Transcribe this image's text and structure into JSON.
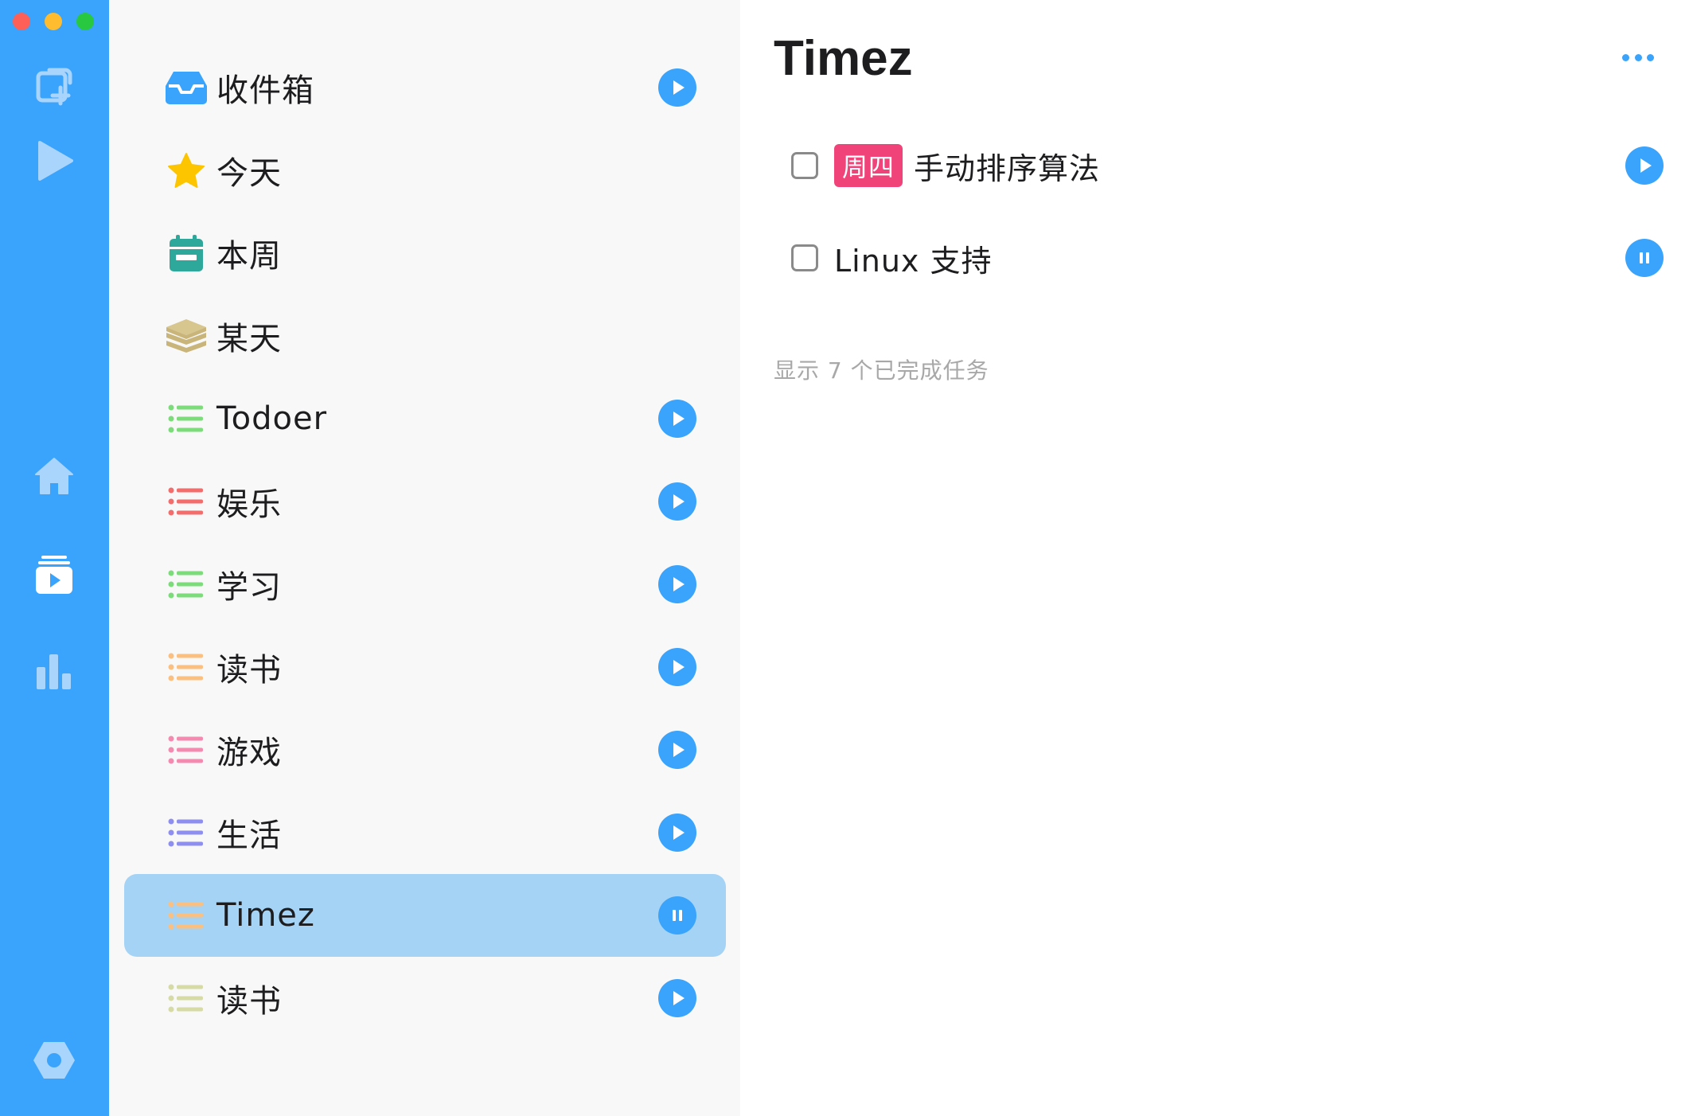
{
  "app": {
    "accent_color": "#3aa3fb",
    "rail": {
      "buttons": [
        {
          "name": "new-task-icon"
        },
        {
          "name": "start-timer-icon"
        },
        {
          "name": "home-icon"
        },
        {
          "name": "timer-list-icon"
        },
        {
          "name": "statistics-icon"
        },
        {
          "name": "settings-icon"
        }
      ]
    }
  },
  "sidebar": {
    "items": [
      {
        "label": "收件箱",
        "icon": "inbox-icon",
        "icon_color": "#3aa3fb",
        "action": "play"
      },
      {
        "label": "今天",
        "icon": "star-icon",
        "icon_color": "#fdc500",
        "action": "none"
      },
      {
        "label": "本周",
        "icon": "calendar-icon",
        "icon_color": "#2ea89b",
        "action": "none"
      },
      {
        "label": "某天",
        "icon": "layers-icon",
        "icon_color": "#d4c089",
        "action": "none"
      },
      {
        "label": "Todoer",
        "icon": "list-icon",
        "icon_color": "#7ddc7a",
        "action": "play"
      },
      {
        "label": "娱乐",
        "icon": "list-icon",
        "icon_color": "#f36d6d",
        "action": "play"
      },
      {
        "label": "学习",
        "icon": "list-icon",
        "icon_color": "#7ddc7a",
        "action": "play"
      },
      {
        "label": "读书",
        "icon": "list-icon",
        "icon_color": "#fbc07f",
        "action": "play"
      },
      {
        "label": "游戏",
        "icon": "list-icon",
        "icon_color": "#f58ab0",
        "action": "play"
      },
      {
        "label": "生活",
        "icon": "list-icon",
        "icon_color": "#8d8ef0",
        "action": "play"
      },
      {
        "label": "Timez",
        "icon": "list-icon",
        "icon_color": "#fbc07f",
        "action": "pause",
        "selected": true
      },
      {
        "label": "读书",
        "icon": "list-icon",
        "icon_color": "#d6dba6",
        "action": "play"
      }
    ]
  },
  "main": {
    "title": "Timez",
    "tasks": [
      {
        "tag": "周四",
        "tag_color": "#f0437a",
        "label": "手动排序算法",
        "checked": false,
        "action": "play"
      },
      {
        "tag": "",
        "label": "Linux 支持",
        "checked": false,
        "action": "pause"
      }
    ],
    "completed_link": "显示 7 个已完成任务"
  }
}
